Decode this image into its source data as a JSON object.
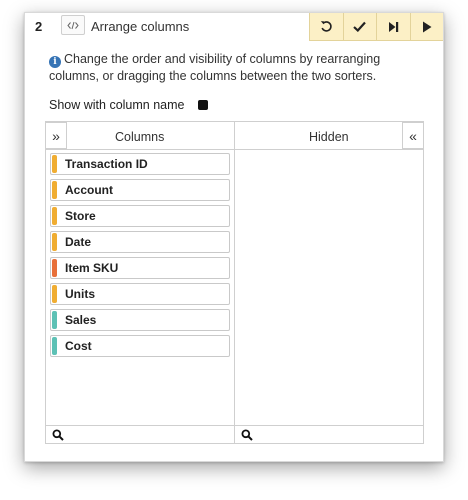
{
  "step": {
    "number": "2",
    "code_icon": "code-icon",
    "title": "Arrange columns"
  },
  "toolbar": {
    "buttons": [
      {
        "name": "undo",
        "icon": "undo-icon"
      },
      {
        "name": "apply",
        "icon": "check-icon"
      },
      {
        "name": "run-to-here",
        "icon": "skip-forward-icon"
      },
      {
        "name": "run",
        "icon": "play-icon"
      }
    ],
    "background": "#fcf0c6"
  },
  "info": {
    "icon": "info-icon",
    "text": "Change the order and visibility of columns by rearranging columns, or dragging the columns between the two sorters."
  },
  "show_column_name": {
    "label": "Show with column name"
  },
  "columns_panel": {
    "title": "Columns",
    "move_button": "»",
    "items": [
      {
        "label": "Transaction ID",
        "color": "#f0ad32"
      },
      {
        "label": "Account",
        "color": "#f0ad32"
      },
      {
        "label": "Store",
        "color": "#f0ad32"
      },
      {
        "label": "Date",
        "color": "#f0ad32"
      },
      {
        "label": "Item SKU",
        "color": "#e8703a"
      },
      {
        "label": "Units",
        "color": "#f0ad32"
      },
      {
        "label": "Sales",
        "color": "#5dc1b5"
      },
      {
        "label": "Cost",
        "color": "#5dc1b5"
      }
    ]
  },
  "hidden_panel": {
    "title": "Hidden",
    "move_button": "«",
    "items": []
  }
}
